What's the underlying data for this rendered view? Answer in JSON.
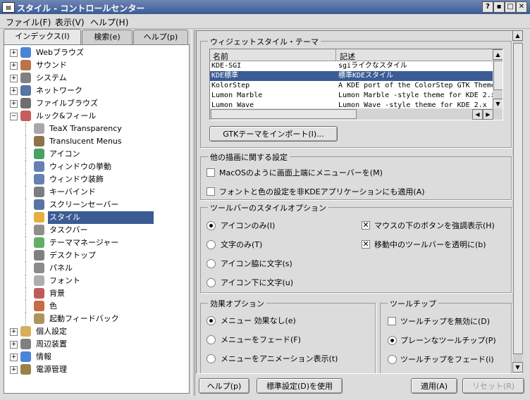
{
  "window": {
    "title": "スタイル - コントロールセンター",
    "controls": [
      "?",
      "▪",
      "□",
      "✕"
    ]
  },
  "menu": [
    "ファイル(F)",
    "表示(V)",
    "ヘルプ(H)"
  ],
  "tabs": [
    {
      "label": "インデックス(I)"
    },
    {
      "label": "検索(e)"
    },
    {
      "label": "ヘルプ(p)"
    }
  ],
  "tree": [
    {
      "label": "Webブラウズ",
      "icon": "globe-icon",
      "expander": "+"
    },
    {
      "label": "サウンド",
      "icon": "sound-icon",
      "expander": "+"
    },
    {
      "label": "システム",
      "icon": "system-icon",
      "expander": "+"
    },
    {
      "label": "ネットワーク",
      "icon": "network-icon",
      "expander": "+"
    },
    {
      "label": "ファイルブラウズ",
      "icon": "file-browse-icon",
      "expander": "+"
    },
    {
      "label": "ルック&フィール",
      "icon": "look-feel-icon",
      "expander": "−"
    },
    {
      "label": "TeaX Transparency",
      "icon": "gear-icon"
    },
    {
      "label": "Translucent Menus",
      "icon": "menu-icon"
    },
    {
      "label": "アイコン",
      "icon": "icons-icon"
    },
    {
      "label": "ウィンドウの挙動",
      "icon": "window-behavior-icon"
    },
    {
      "label": "ウィンドウ装飾",
      "icon": "window-deco-icon"
    },
    {
      "label": "キーバインド",
      "icon": "keyboard-icon"
    },
    {
      "label": "スクリーンセーバー",
      "icon": "screensaver-icon"
    },
    {
      "label": "スタイル",
      "icon": "style-icon",
      "selected": true
    },
    {
      "label": "タスクバー",
      "icon": "taskbar-icon"
    },
    {
      "label": "テーママネージャー",
      "icon": "theme-icon"
    },
    {
      "label": "デスクトップ",
      "icon": "desktop-icon"
    },
    {
      "label": "パネル",
      "icon": "panel-icon"
    },
    {
      "label": "フォント",
      "icon": "font-icon"
    },
    {
      "label": "背景",
      "icon": "background-icon"
    },
    {
      "label": "色",
      "icon": "color-icon"
    },
    {
      "label": "起動フィードバック",
      "icon": "launch-feedback-icon"
    },
    {
      "label": "個人設定",
      "icon": "user-icon",
      "expander": "+"
    },
    {
      "label": "周辺装置",
      "icon": "peripheral-icon",
      "expander": "+"
    },
    {
      "label": "情報",
      "icon": "info-icon",
      "expander": "+"
    },
    {
      "label": "電源管理",
      "icon": "power-icon",
      "expander": "+"
    }
  ],
  "widget_style": {
    "title": "ウィジェットスタイル・テーマ",
    "columns": [
      "名前",
      "記述"
    ],
    "rows": [
      {
        "name": "KDE-SGI",
        "desc": "sgiライクなスタイル"
      },
      {
        "name": "KDE標準",
        "desc": "標準KDEスタイル",
        "selected": true
      },
      {
        "name": "KolorStep",
        "desc": "A KDE port of the ColorStep GTK Theme"
      },
      {
        "name": "Lumon Marble",
        "desc": "Lumon Marble -style theme for KDE 2.x"
      },
      {
        "name": "Lumon Wave",
        "desc": "Lumon Wave -style theme for KDE 2.x"
      }
    ],
    "import_button": "GTKテーマをインポート(I)..."
  },
  "other_drawing": {
    "title": "他の描画に関する設定",
    "options": [
      {
        "label": "MacOSのように画面上端にメニューバーを(M)",
        "checked": false
      },
      {
        "label": "フォントと色の設定を非KDEアプリケーションにも適用(A)",
        "checked": false
      }
    ]
  },
  "toolbar_style": {
    "title": "ツールバーのスタイルオプション",
    "radios": [
      {
        "label": "アイコンのみ(I)",
        "checked": true
      },
      {
        "label": "文字のみ(T)",
        "checked": false
      },
      {
        "label": "アイコン脇に文字(s)",
        "checked": false
      },
      {
        "label": "アイコン下に文字(u)",
        "checked": false
      }
    ],
    "checks": [
      {
        "label": "マウスの下のボタンを強調表示(H)",
        "checked": true
      },
      {
        "label": "移動中のツールバーを透明に(b)",
        "checked": true
      }
    ]
  },
  "effects": {
    "title": "効果オプション",
    "radios": [
      {
        "label": "メニュー 効果なし(e)",
        "checked": true
      },
      {
        "label": "メニューをフェード(F)",
        "checked": false
      },
      {
        "label": "メニューをアニメーション表示(t)",
        "checked": false
      }
    ]
  },
  "tooltips": {
    "title": "ツールチップ",
    "options": [
      {
        "label": "ツールチップを無効に(D)",
        "type": "check",
        "checked": false
      },
      {
        "label": "プレーンなツールチップ(P)",
        "type": "radio",
        "checked": true
      },
      {
        "label": "ツールチップをフェード(i)",
        "type": "radio",
        "checked": false
      }
    ]
  },
  "buttons": {
    "help": "ヘルプ(p)",
    "defaults": "標準設定(D)を使用",
    "apply": "適用(A)",
    "reset": "リセット(R)"
  },
  "colors": {
    "selection": "#3b5b94",
    "titlebar": "#4a6aa4"
  }
}
